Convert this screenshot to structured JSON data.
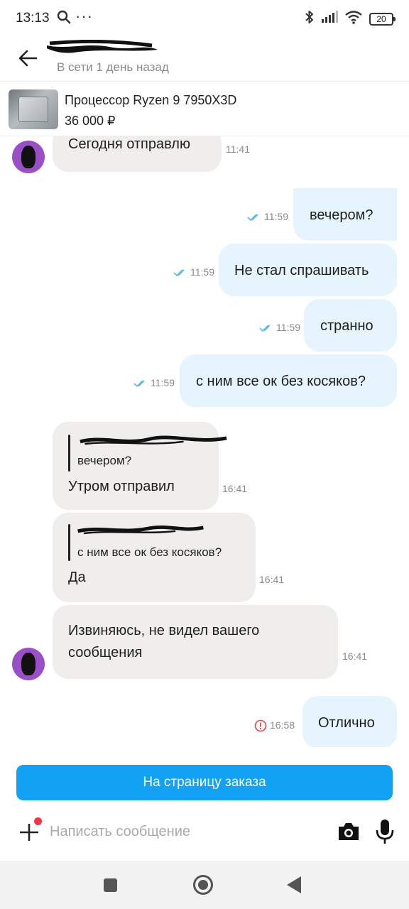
{
  "status_bar": {
    "time": "13:13",
    "battery": "20",
    "icons": [
      "search-icon",
      "more-dots-icon",
      "bluetooth-icon",
      "signal-icon",
      "wifi-icon",
      "battery-icon"
    ]
  },
  "header": {
    "contact_name": "",
    "online_status": "В сети 1 день назад"
  },
  "product": {
    "title": "Процессор Ryzen 9 7950X3D",
    "price": "36 000 ₽"
  },
  "messages": [
    {
      "direction": "in",
      "text": "Сегодня отправлю",
      "time": "11:41"
    },
    {
      "direction": "out",
      "text": "вечером?",
      "time": "11:59",
      "status": "read"
    },
    {
      "direction": "out",
      "text": "Не стал спрашивать",
      "time": "11:59",
      "status": "read"
    },
    {
      "direction": "out",
      "text": "странно",
      "time": "11:59",
      "status": "read"
    },
    {
      "direction": "out",
      "text": "с ним все ок без косяков?",
      "time": "11:59",
      "status": "read"
    },
    {
      "direction": "in",
      "quote": "вечером?",
      "text": "Утром отправил",
      "time": "16:41"
    },
    {
      "direction": "in",
      "quote": "с ним все ок без косяков?",
      "text": "Да",
      "time": "16:41"
    },
    {
      "direction": "in",
      "text_line1": "Извиняюсь, не видел вашего",
      "text_line2": "сообщения",
      "time": "16:41"
    },
    {
      "direction": "out",
      "text": "Отлично",
      "time": "16:58",
      "status": "error"
    }
  ],
  "order_button": {
    "label": "На страницу заказа"
  },
  "composer": {
    "placeholder": "Написать сообщение"
  },
  "colors": {
    "accent": "#13a1f3",
    "incoming_bubble": "#efeeec",
    "outgoing_bubble": "#e5f4fd",
    "avatar": "#9b4fc7",
    "error": "#e0454f",
    "read_check": "#5ab8e8"
  }
}
